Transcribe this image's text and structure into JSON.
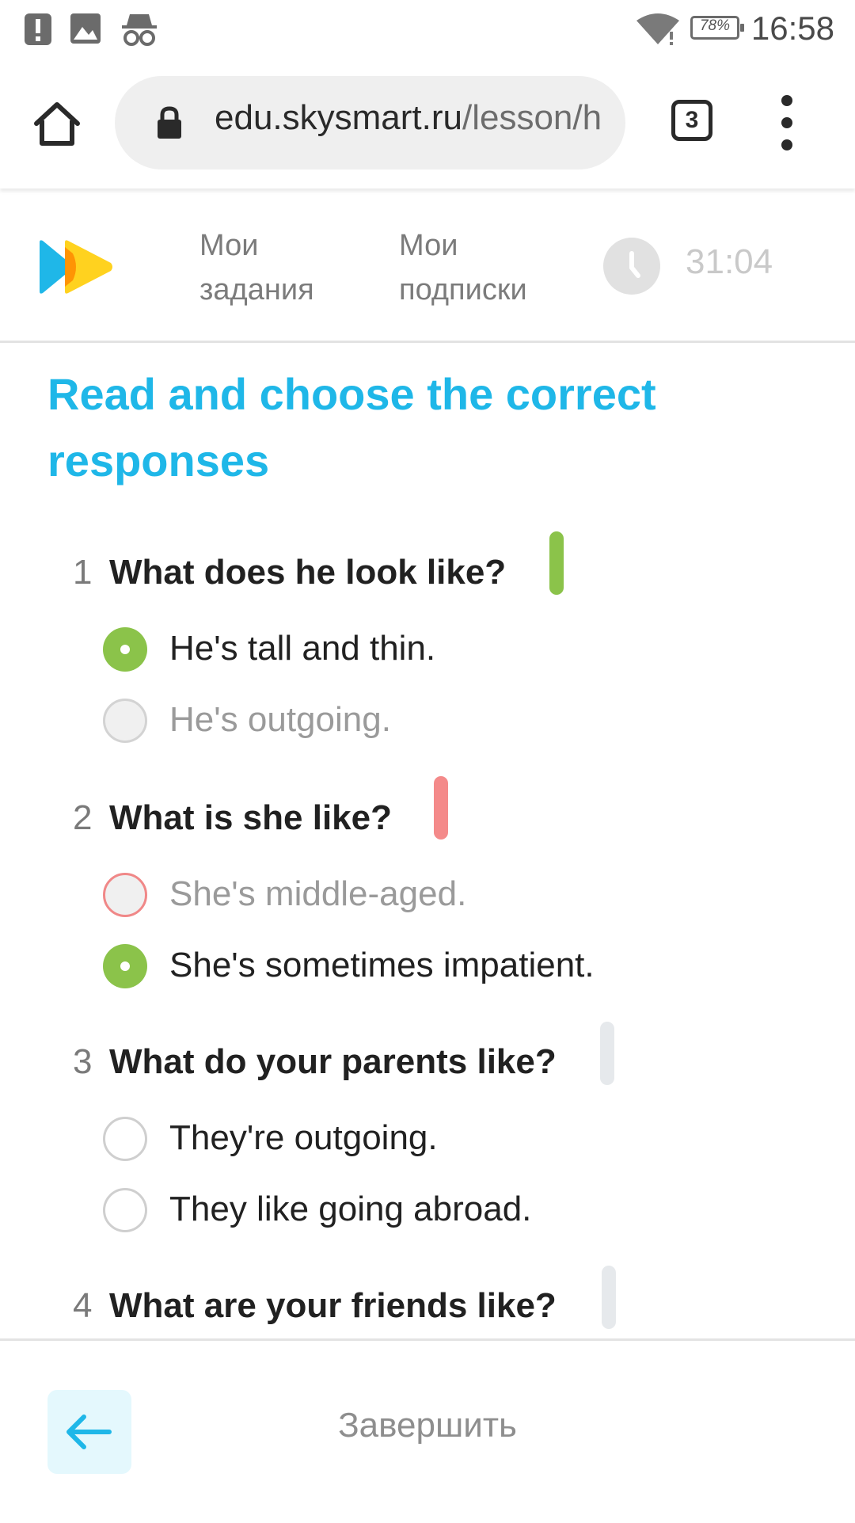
{
  "status_bar": {
    "icons": [
      "alert-icon",
      "image-icon",
      "incognito-icon",
      "wifi-icon"
    ],
    "battery": "78%",
    "time": "16:58"
  },
  "browser": {
    "url_domain": "edu.skysmart.ru",
    "url_path": "/lesson/h",
    "tab_count": "3"
  },
  "header": {
    "nav": [
      {
        "line1": "Мои",
        "line2": "задания"
      },
      {
        "line1": "Мои",
        "line2": "подписки"
      }
    ],
    "timer": "31:04"
  },
  "task": {
    "title": "Read and choose the correct responses",
    "questions": [
      {
        "number": "1",
        "text": "What does he look like?",
        "status": "correct",
        "options": [
          {
            "label": "He's tall and thin.",
            "state": "selected"
          },
          {
            "label": "He's outgoing.",
            "state": "disabled"
          }
        ]
      },
      {
        "number": "2",
        "text": "What is she like?",
        "status": "wrong",
        "options": [
          {
            "label": "She's middle-aged.",
            "state": "wrong"
          },
          {
            "label": "She's sometimes impatient.",
            "state": "selected"
          }
        ]
      },
      {
        "number": "3",
        "text": "What do your parents like?",
        "status": "unanswered",
        "options": [
          {
            "label": "They're outgoing.",
            "state": "empty"
          },
          {
            "label": "They like going abroad.",
            "state": "empty"
          }
        ]
      },
      {
        "number": "4",
        "text": "What are your friends like?",
        "status": "unanswered",
        "options": []
      }
    ]
  },
  "footer": {
    "finish_label": "Завершить"
  },
  "colors": {
    "accent": "#1fb7e8",
    "correct": "#8bc34a",
    "wrong": "#f48a8a",
    "neutral": "#e6e9ec"
  }
}
